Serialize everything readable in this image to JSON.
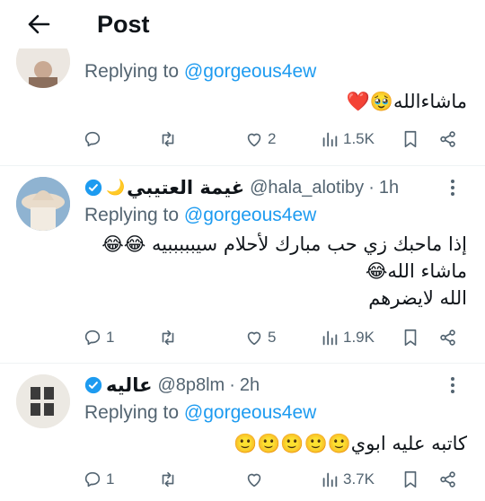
{
  "header": {
    "title": "Post"
  },
  "tweets": [
    {
      "replying_prefix": "Replying to ",
      "replying_to": "@gorgeous4ew",
      "lines": [
        "ماشاءالله🥹❤️"
      ],
      "actions": {
        "replies": "",
        "reposts": "",
        "likes": "2",
        "views": "1.5K"
      }
    },
    {
      "display_name": "غيمة العتيبي",
      "name_emoji": "🌙",
      "handle": "@hala_alotiby",
      "time": "1h",
      "replying_prefix": "Replying to ",
      "replying_to": "@gorgeous4ew",
      "lines": [
        "إذا ماحبك زي حب مبارك لأحلام سيبببببيه 😂😂",
        "ماشاء الله😂",
        "الله لايضرهم"
      ],
      "actions": {
        "replies": "1",
        "reposts": "",
        "likes": "5",
        "views": "1.9K"
      }
    },
    {
      "display_name": "عاليه",
      "handle": "@8p8lm",
      "time": "2h",
      "replying_prefix": "Replying to ",
      "replying_to": "@gorgeous4ew",
      "lines": [
        "كاتبه عليه ابوي🙂🙂🙂🙂🙂"
      ],
      "actions": {
        "replies": "1",
        "reposts": "",
        "likes": "",
        "views": "3.7K"
      }
    }
  ],
  "colors": {
    "accent": "#1d9bf0",
    "secondary_text": "#536471",
    "heart": "#e0245e"
  }
}
